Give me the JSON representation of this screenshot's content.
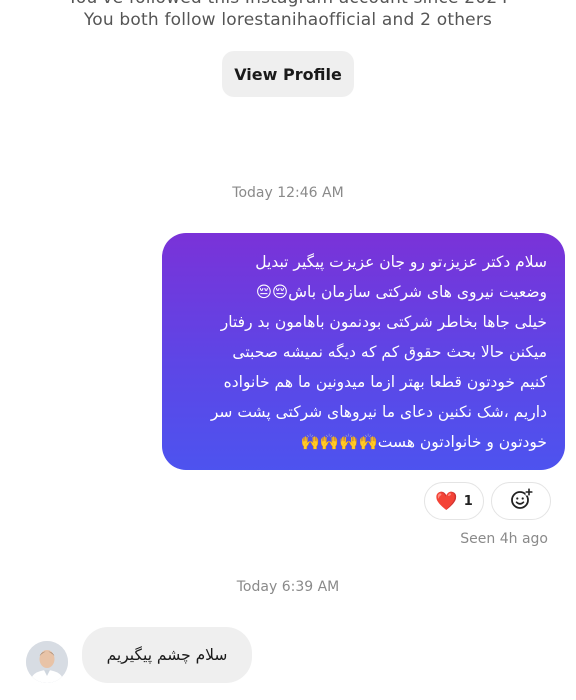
{
  "header": {
    "followed_line": "You've followed this Instagram account since 2024",
    "mutual_line": "You both follow lorestanihaofficial and 2 others",
    "view_profile_label": "View Profile"
  },
  "timestamps": {
    "first": "Today 12:46 AM",
    "second": "Today 6:39 AM"
  },
  "messages": {
    "sent": {
      "lines": [
        "سلام دکتر عزیز،تو رو جان عزیزت پیگیر تبدیل",
        "وضعیت نیروی های شرکتی سازمان باش😔😔",
        "خیلی  جاها بخاطر شرکتی بودنمون باهامون بد رفتار",
        "میکنن حالا بحث حقوق کم که دیگه نمیشه صحبتی",
        "کنیم خودتون قطعا بهتر ازما میدونین ما هم خانواده",
        "داریم ،شک نکنین دعای ما نیروهای شرکتی پشت سر",
        "خودتون و خانوادتون هست🙌🙌🙌🙌"
      ],
      "reaction_emoji": "❤️",
      "reaction_count": "1",
      "seen_text": "Seen 4h ago"
    },
    "received": {
      "text": "سلام چشم پیگیریم"
    }
  },
  "icons": {
    "heart": "heart-icon",
    "add_reaction": "add-reaction-icon",
    "avatar": "profile-avatar"
  },
  "colors": {
    "bubble_gradient_top": "#7a32d8",
    "bubble_gradient_bottom": "#4d53ef",
    "heart": "#e0213a"
  }
}
